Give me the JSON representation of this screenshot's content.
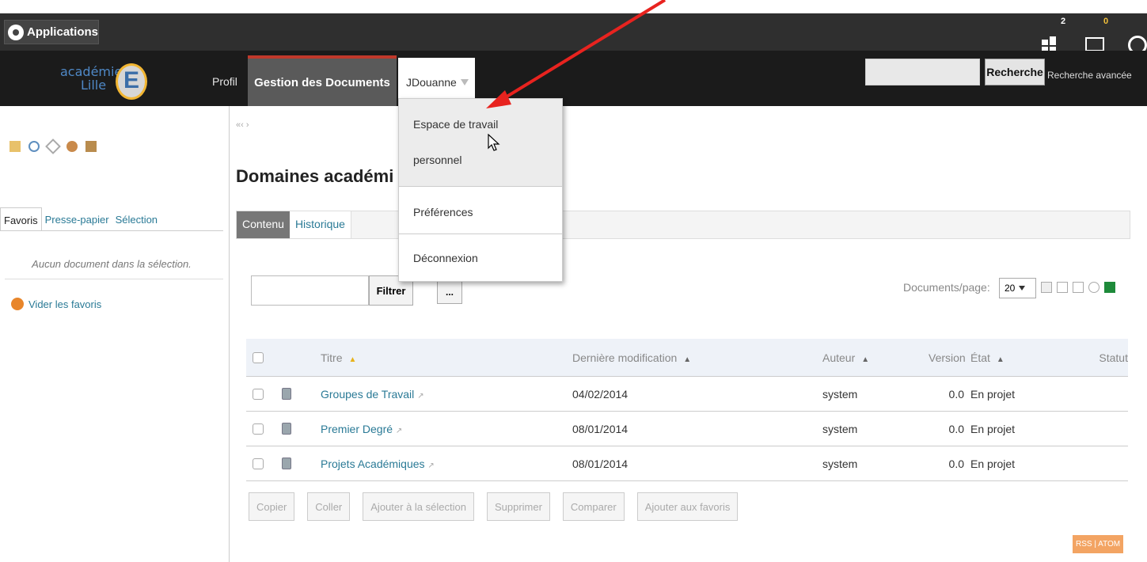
{
  "topbar": {
    "applications_label": "Applications",
    "workspace_badge": "2",
    "mail_badge": "0"
  },
  "navbar": {
    "logo_line1": "académie",
    "logo_line2": "Lille",
    "logo_letter": "E",
    "profil": "Profil",
    "gestion": "Gestion des Documents",
    "user": "JDouanne",
    "search_button": "Recherche",
    "advanced_search": "Recherche avancée"
  },
  "dropdown": {
    "item1_line1": "Espace de travail",
    "item1_line2": "personnel",
    "item2": "Préférences",
    "item3": "Déconnexion"
  },
  "sidebar": {
    "tabs": [
      "Favoris",
      "Presse-papier",
      "Sélection"
    ],
    "empty_message": "Aucun document dans la sélection.",
    "clear_favorites": "Vider les favoris"
  },
  "main": {
    "breadcrumb": "«‹ ›",
    "title": "Domaines académi",
    "tabs": [
      "Contenu",
      "Historique"
    ],
    "filter_button": "Filtrer",
    "more_button": "...",
    "docs_per_page_label": "Documents/page:",
    "docs_per_page_value": "20"
  },
  "table": {
    "headers": [
      "Titre",
      "Dernière modification",
      "Auteur",
      "Version",
      "État",
      "Statut"
    ],
    "rows": [
      {
        "title": "Groupes de Travail",
        "modified": "04/02/2014",
        "author": "system",
        "version": "0.0",
        "state": "En projet",
        "status": ""
      },
      {
        "title": "Premier Degré",
        "modified": "08/01/2014",
        "author": "system",
        "version": "0.0",
        "state": "En projet",
        "status": ""
      },
      {
        "title": "Projets Académiques",
        "modified": "08/01/2014",
        "author": "system",
        "version": "0.0",
        "state": "En projet",
        "status": ""
      }
    ]
  },
  "actions": [
    "Copier",
    "Coller",
    "Ajouter à la sélection",
    "Supprimer",
    "Comparer",
    "Ajouter aux favoris"
  ],
  "rss": "RSS | ATOM",
  "colors": {
    "link": "#2a7a96",
    "accent_tab": "#c0392b",
    "annotation_arrow": "#e8231f"
  }
}
